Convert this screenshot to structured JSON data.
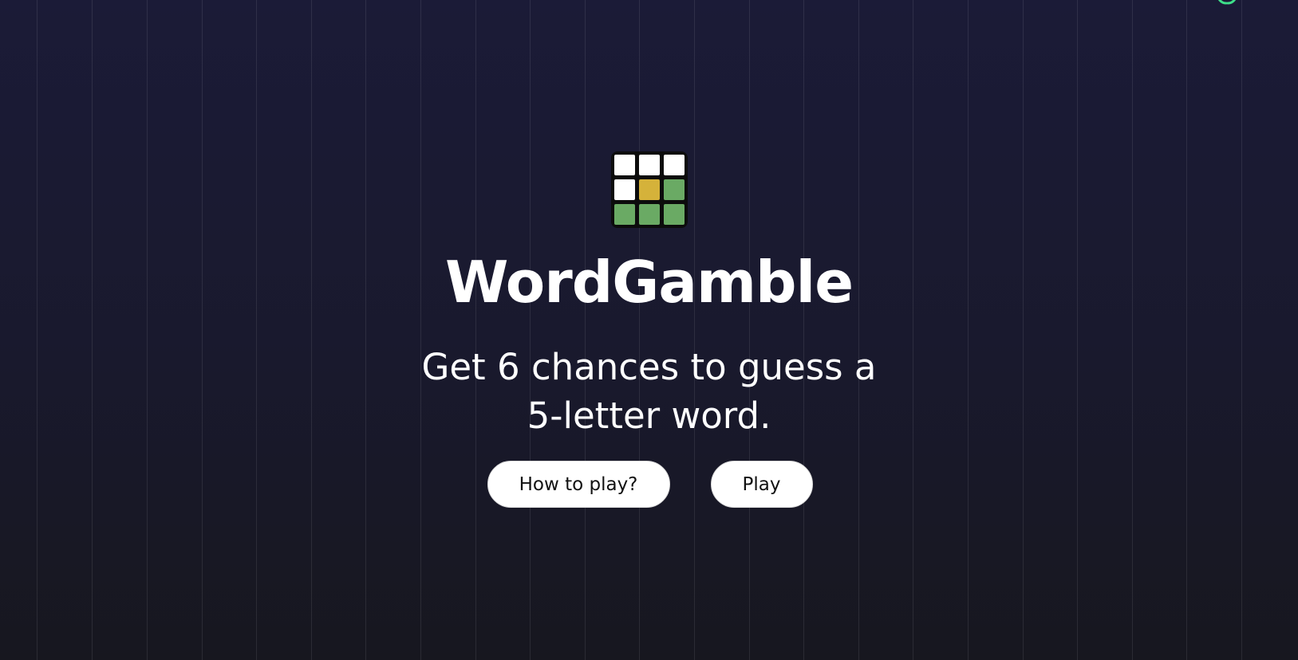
{
  "app": {
    "title": "WordGamble",
    "tagline": "Get 6 chances to guess a 5-letter word."
  },
  "logo": {
    "tiles": [
      "white",
      "white",
      "white",
      "white",
      "yellow",
      "green",
      "green",
      "green",
      "green"
    ],
    "colors": {
      "white": "#ffffff",
      "yellow": "#d5b23a",
      "green": "#6aaa64"
    }
  },
  "actions": {
    "how_to_play_label": "How to play?",
    "play_label": "Play"
  },
  "theme": {
    "background_top": "#1b1b37",
    "background_bottom": "#17171f",
    "accent": "#3ee08a"
  },
  "corner_icon": "spinner-icon"
}
